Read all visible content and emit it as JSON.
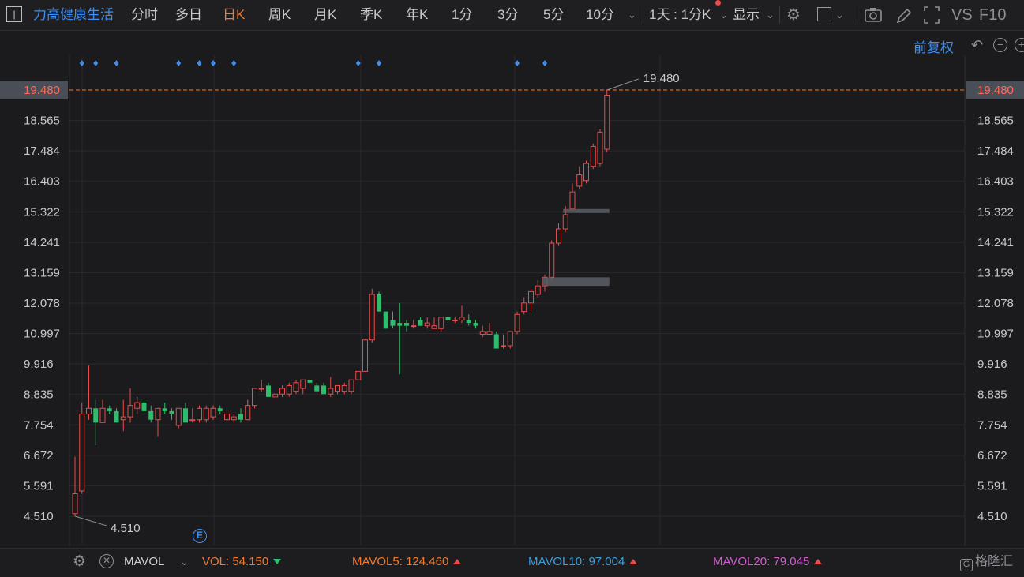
{
  "toolbar": {
    "stock_name": "力高健康生活",
    "periods": [
      "分时",
      "多日",
      "日K",
      "周K",
      "月K",
      "季K",
      "年K",
      "1分",
      "3分",
      "5分",
      "10分"
    ],
    "selected_period": "日K",
    "combo": "1天 : 1分K",
    "display": "显示",
    "vs_label": "VS",
    "f10_label": "F10"
  },
  "adjust_label": "前复权",
  "price_axis": {
    "ticks": [
      "19.480",
      "18.565",
      "17.484",
      "16.403",
      "15.322",
      "14.241",
      "13.159",
      "12.078",
      "10.997",
      "9.916",
      "8.835",
      "7.754",
      "6.672",
      "5.591",
      "4.510"
    ],
    "current_price": "19.480",
    "high_label": "19.480",
    "low_label": "4.510",
    "ymin": 4.51,
    "ymax": 19.48
  },
  "event_marker": "E",
  "volume_bar": {
    "indicator": "MAVOL",
    "vol_label": "VOL:",
    "vol_value": "54.150",
    "mavol5_label": "MAVOL5:",
    "mavol5_value": "124.460",
    "mavol10_label": "MAVOL10:",
    "mavol10_value": "97.004",
    "mavol20_label": "MAVOL20:",
    "mavol20_value": "79.045"
  },
  "watermark": "格隆汇",
  "colors": {
    "up": "#e84c4c",
    "down": "#2ebd6c",
    "accent": "#f07a2e",
    "blue": "#3f8ff0",
    "mavol5": "#f07a2e",
    "mavol10": "#3aa0e0",
    "mavol20": "#d060d0"
  },
  "candles": [
    {
      "o": 4.6,
      "h": 6.6,
      "l": 4.51,
      "c": 5.3
    },
    {
      "o": 5.4,
      "h": 8.5,
      "l": 5.3,
      "c": 8.1
    },
    {
      "o": 8.1,
      "h": 9.8,
      "l": 7.9,
      "c": 8.3
    },
    {
      "o": 8.3,
      "h": 8.6,
      "l": 7.0,
      "c": 7.8
    },
    {
      "o": 7.8,
      "h": 8.6,
      "l": 7.8,
      "c": 8.3
    },
    {
      "o": 8.3,
      "h": 8.4,
      "l": 8.1,
      "c": 8.2
    },
    {
      "o": 8.2,
      "h": 8.3,
      "l": 7.8,
      "c": 7.8
    },
    {
      "o": 7.9,
      "h": 8.6,
      "l": 7.5,
      "c": 8.0
    },
    {
      "o": 8.0,
      "h": 9.0,
      "l": 7.8,
      "c": 8.4
    },
    {
      "o": 8.3,
      "h": 8.7,
      "l": 8.1,
      "c": 8.5
    },
    {
      "o": 8.5,
      "h": 8.6,
      "l": 8.2,
      "c": 8.2
    },
    {
      "o": 8.2,
      "h": 8.4,
      "l": 7.8,
      "c": 7.9
    },
    {
      "o": 7.9,
      "h": 8.3,
      "l": 7.3,
      "c": 8.3
    },
    {
      "o": 8.3,
      "h": 8.5,
      "l": 8.1,
      "c": 8.2
    },
    {
      "o": 8.2,
      "h": 8.3,
      "l": 7.9,
      "c": 8.1
    },
    {
      "o": 7.7,
      "h": 8.3,
      "l": 7.6,
      "c": 8.3
    },
    {
      "o": 8.3,
      "h": 8.5,
      "l": 7.8,
      "c": 7.8
    },
    {
      "o": 7.9,
      "h": 8.3,
      "l": 7.8,
      "c": 7.9
    },
    {
      "o": 7.9,
      "h": 8.4,
      "l": 7.8,
      "c": 8.3
    },
    {
      "o": 7.9,
      "h": 8.4,
      "l": 7.8,
      "c": 8.3
    },
    {
      "o": 8.0,
      "h": 8.4,
      "l": 7.9,
      "c": 8.3
    },
    {
      "o": 8.3,
      "h": 8.4,
      "l": 8.1,
      "c": 8.2
    },
    {
      "o": 7.9,
      "h": 8.1,
      "l": 7.8,
      "c": 8.1
    },
    {
      "o": 7.9,
      "h": 8.1,
      "l": 7.8,
      "c": 8.0
    },
    {
      "o": 8.1,
      "h": 8.3,
      "l": 7.8,
      "c": 7.9
    },
    {
      "o": 7.9,
      "h": 8.6,
      "l": 7.9,
      "c": 8.4
    },
    {
      "o": 8.4,
      "h": 9.0,
      "l": 8.3,
      "c": 9.0
    },
    {
      "o": 9.0,
      "h": 9.3,
      "l": 8.9,
      "c": 9.0
    },
    {
      "o": 9.1,
      "h": 9.2,
      "l": 8.7,
      "c": 8.7
    },
    {
      "o": 8.7,
      "h": 8.8,
      "l": 8.7,
      "c": 8.8
    },
    {
      "o": 8.8,
      "h": 9.1,
      "l": 8.7,
      "c": 9.0
    },
    {
      "o": 8.8,
      "h": 9.2,
      "l": 8.7,
      "c": 9.1
    },
    {
      "o": 8.9,
      "h": 9.3,
      "l": 8.8,
      "c": 9.2
    },
    {
      "o": 9.0,
      "h": 9.2,
      "l": 8.8,
      "c": 9.3
    },
    {
      "o": 9.3,
      "h": 9.3,
      "l": 9.2,
      "c": 9.2
    },
    {
      "o": 9.1,
      "h": 9.2,
      "l": 8.9,
      "c": 8.9
    },
    {
      "o": 9.1,
      "h": 9.2,
      "l": 8.8,
      "c": 8.8
    },
    {
      "o": 8.8,
      "h": 9.4,
      "l": 8.7,
      "c": 9.0
    },
    {
      "o": 8.9,
      "h": 9.1,
      "l": 8.8,
      "c": 9.1
    },
    {
      "o": 8.9,
      "h": 9.2,
      "l": 8.8,
      "c": 9.1
    },
    {
      "o": 8.9,
      "h": 9.2,
      "l": 8.8,
      "c": 9.3
    },
    {
      "o": 9.3,
      "h": 9.6,
      "l": 9.3,
      "c": 9.6
    },
    {
      "o": 9.6,
      "h": 10.7,
      "l": 9.6,
      "c": 10.7
    },
    {
      "o": 10.7,
      "h": 12.5,
      "l": 10.6,
      "c": 12.3
    },
    {
      "o": 12.3,
      "h": 12.4,
      "l": 11.7,
      "c": 11.7
    },
    {
      "o": 11.7,
      "h": 11.7,
      "l": 11.1,
      "c": 11.1
    },
    {
      "o": 11.4,
      "h": 11.7,
      "l": 11.1,
      "c": 11.2
    },
    {
      "o": 11.3,
      "h": 12.0,
      "l": 9.5,
      "c": 11.2
    },
    {
      "o": 11.3,
      "h": 11.4,
      "l": 11.0,
      "c": 11.2
    },
    {
      "o": 11.2,
      "h": 11.4,
      "l": 11.1,
      "c": 11.2
    },
    {
      "o": 11.4,
      "h": 11.5,
      "l": 11.2,
      "c": 11.2
    },
    {
      "o": 11.2,
      "h": 11.5,
      "l": 11.1,
      "c": 11.3
    },
    {
      "o": 11.1,
      "h": 11.5,
      "l": 11.1,
      "c": 11.2
    },
    {
      "o": 11.1,
      "h": 11.5,
      "l": 11.0,
      "c": 11.5
    },
    {
      "o": 11.5,
      "h": 11.5,
      "l": 11.3,
      "c": 11.4
    },
    {
      "o": 11.4,
      "h": 11.5,
      "l": 11.3,
      "c": 11.4
    },
    {
      "o": 11.4,
      "h": 11.9,
      "l": 11.3,
      "c": 11.5
    },
    {
      "o": 11.4,
      "h": 11.6,
      "l": 11.2,
      "c": 11.3
    },
    {
      "o": 11.3,
      "h": 11.4,
      "l": 11.1,
      "c": 11.2
    },
    {
      "o": 10.9,
      "h": 11.2,
      "l": 10.8,
      "c": 11.0
    },
    {
      "o": 10.9,
      "h": 11.3,
      "l": 10.9,
      "c": 11.0
    },
    {
      "o": 10.9,
      "h": 11.0,
      "l": 10.4,
      "c": 10.4
    },
    {
      "o": 10.5,
      "h": 10.9,
      "l": 10.4,
      "c": 10.5
    },
    {
      "o": 10.5,
      "h": 11.0,
      "l": 10.4,
      "c": 11.0
    },
    {
      "o": 11.0,
      "h": 11.7,
      "l": 10.9,
      "c": 11.6
    },
    {
      "o": 11.7,
      "h": 12.2,
      "l": 11.6,
      "c": 12.0
    },
    {
      "o": 12.0,
      "h": 12.5,
      "l": 11.7,
      "c": 12.4
    },
    {
      "o": 12.3,
      "h": 12.8,
      "l": 12.2,
      "c": 12.6
    },
    {
      "o": 12.6,
      "h": 13.0,
      "l": 12.4,
      "c": 12.9
    },
    {
      "o": 12.9,
      "h": 14.2,
      "l": 12.8,
      "c": 14.1
    },
    {
      "o": 14.1,
      "h": 14.8,
      "l": 14.0,
      "c": 14.6
    },
    {
      "o": 14.6,
      "h": 15.4,
      "l": 14.5,
      "c": 15.1
    },
    {
      "o": 15.3,
      "h": 16.2,
      "l": 15.3,
      "c": 15.9
    },
    {
      "o": 16.1,
      "h": 16.8,
      "l": 16.0,
      "c": 16.5
    },
    {
      "o": 16.3,
      "h": 17.0,
      "l": 16.2,
      "c": 16.9
    },
    {
      "o": 16.8,
      "h": 17.6,
      "l": 16.7,
      "c": 17.5
    },
    {
      "o": 16.9,
      "h": 18.1,
      "l": 16.8,
      "c": 18.0
    },
    {
      "o": 17.4,
      "h": 19.48,
      "l": 17.3,
      "c": 19.3
    }
  ],
  "gap_boxes": [
    {
      "top": 12.9,
      "bottom": 12.6,
      "from_index": 68,
      "to_index": 77
    },
    {
      "top": 15.3,
      "bottom": 15.2,
      "from_index": 71,
      "to_index": 77
    }
  ],
  "event_dot_indices": [
    1,
    3,
    6,
    15,
    18,
    20,
    23,
    41,
    44,
    64,
    68
  ]
}
